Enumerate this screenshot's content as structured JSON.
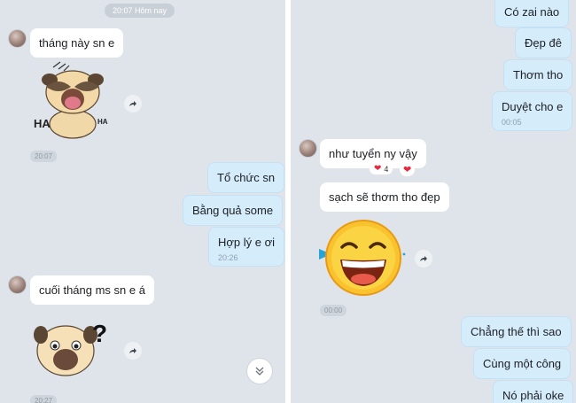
{
  "left": {
    "date_label": "20:07 Hôm nay",
    "messages": [
      {
        "text": "tháng này sn e"
      },
      {
        "text": "Tổ chức sn"
      },
      {
        "text": "Bằng quả some"
      },
      {
        "text": "Hợp lý e ơi",
        "time": "20:26"
      },
      {
        "text": "cuối tháng ms sn e á"
      }
    ],
    "sticker1_time": "20:07",
    "sticker1_text_big": "HA",
    "sticker1_text_small": "HA",
    "sticker2_time": "20:27",
    "sticker2_glyph": "?"
  },
  "right": {
    "messages": [
      {
        "text": "Có zai nào"
      },
      {
        "text": "Đẹp đê"
      },
      {
        "text": "Thơm tho"
      },
      {
        "text": "Duyệt cho e",
        "time": "00:05"
      },
      {
        "text": "như tuyển ny vậy"
      },
      {
        "text": "sạch sẽ thơm tho đẹp"
      },
      {
        "text": "Chẳng thế thì sao"
      },
      {
        "text": "Cùng một công"
      },
      {
        "text": "Nó phải oke"
      }
    ],
    "reaction_count": "4",
    "sticker_time": "00:00"
  },
  "colors": {
    "background": "#dfe4ea",
    "received_bubble": "#ffffff",
    "sent_bubble": "#d5ecfb",
    "reaction_heart": "#e8263d"
  }
}
